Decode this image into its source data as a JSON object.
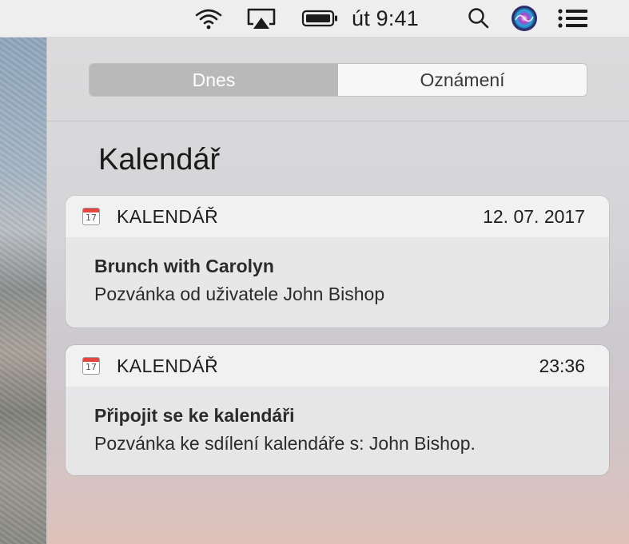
{
  "menubar": {
    "icons": [
      "wifi-icon",
      "airplay-icon",
      "battery-icon",
      "spotlight-search-icon",
      "siri-icon",
      "notification-center-icon"
    ],
    "clock": "út 9:41"
  },
  "segmented": {
    "tabs": [
      {
        "label": "Dnes",
        "selected": true
      },
      {
        "label": "Oznámení",
        "selected": false
      }
    ]
  },
  "section": {
    "title": "Kalendář"
  },
  "notifications": [
    {
      "app": "KALENDÁŘ",
      "icon": "calendar-icon",
      "icon_number": "17",
      "timestamp": "12. 07. 2017",
      "title": "Brunch with Carolyn",
      "text": "Pozvánka od uživatele John Bishop"
    },
    {
      "app": "KALENDÁŘ",
      "icon": "calendar-icon",
      "icon_number": "17",
      "timestamp": "23:36",
      "title": "Připojit se ke kalendáři",
      "text": "Pozvánka ke sdílení kalendáře s: John Bishop."
    }
  ],
  "colors": {
    "siri_gradient": [
      "#2b2f6e",
      "#c13fd4",
      "#1fb8e8"
    ],
    "calendar_red": "#e5463f"
  }
}
